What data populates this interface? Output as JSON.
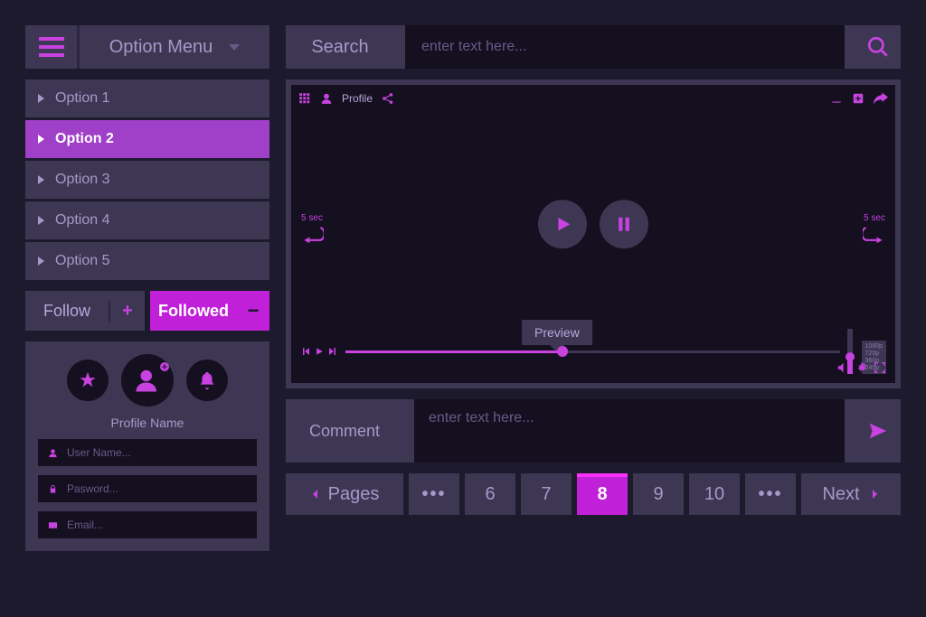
{
  "colors": {
    "accent": "#c842e0",
    "accentBright": "#c020d8",
    "panel": "#3d3754",
    "dark": "#14101f",
    "text": "#a898c8"
  },
  "menu": {
    "title": "Option Menu",
    "options": [
      "Option 1",
      "Option 2",
      "Option 3",
      "Option 4",
      "Option 5"
    ],
    "activeIndex": 1
  },
  "follow": {
    "follow_label": "Follow",
    "followed_label": "Followed"
  },
  "profile": {
    "name": "Profile Name",
    "username_placeholder": "User Name...",
    "password_placeholder": "Pasword...",
    "email_placeholder": "Email..."
  },
  "search": {
    "label": "Search",
    "placeholder": "enter text here..."
  },
  "player": {
    "profile_label": "Profile",
    "rewind_label": "5 sec",
    "forward_label": "5 sec",
    "preview_label": "Preview",
    "progress_percent": 44,
    "quality_options": [
      "1080p",
      "720p",
      "360p",
      "240p"
    ]
  },
  "comment": {
    "label": "Comment",
    "placeholder": "enter text here..."
  },
  "pagination": {
    "label": "Pages",
    "numbers": [
      6,
      7,
      8,
      9,
      10
    ],
    "active": 8,
    "next_label": "Next"
  }
}
